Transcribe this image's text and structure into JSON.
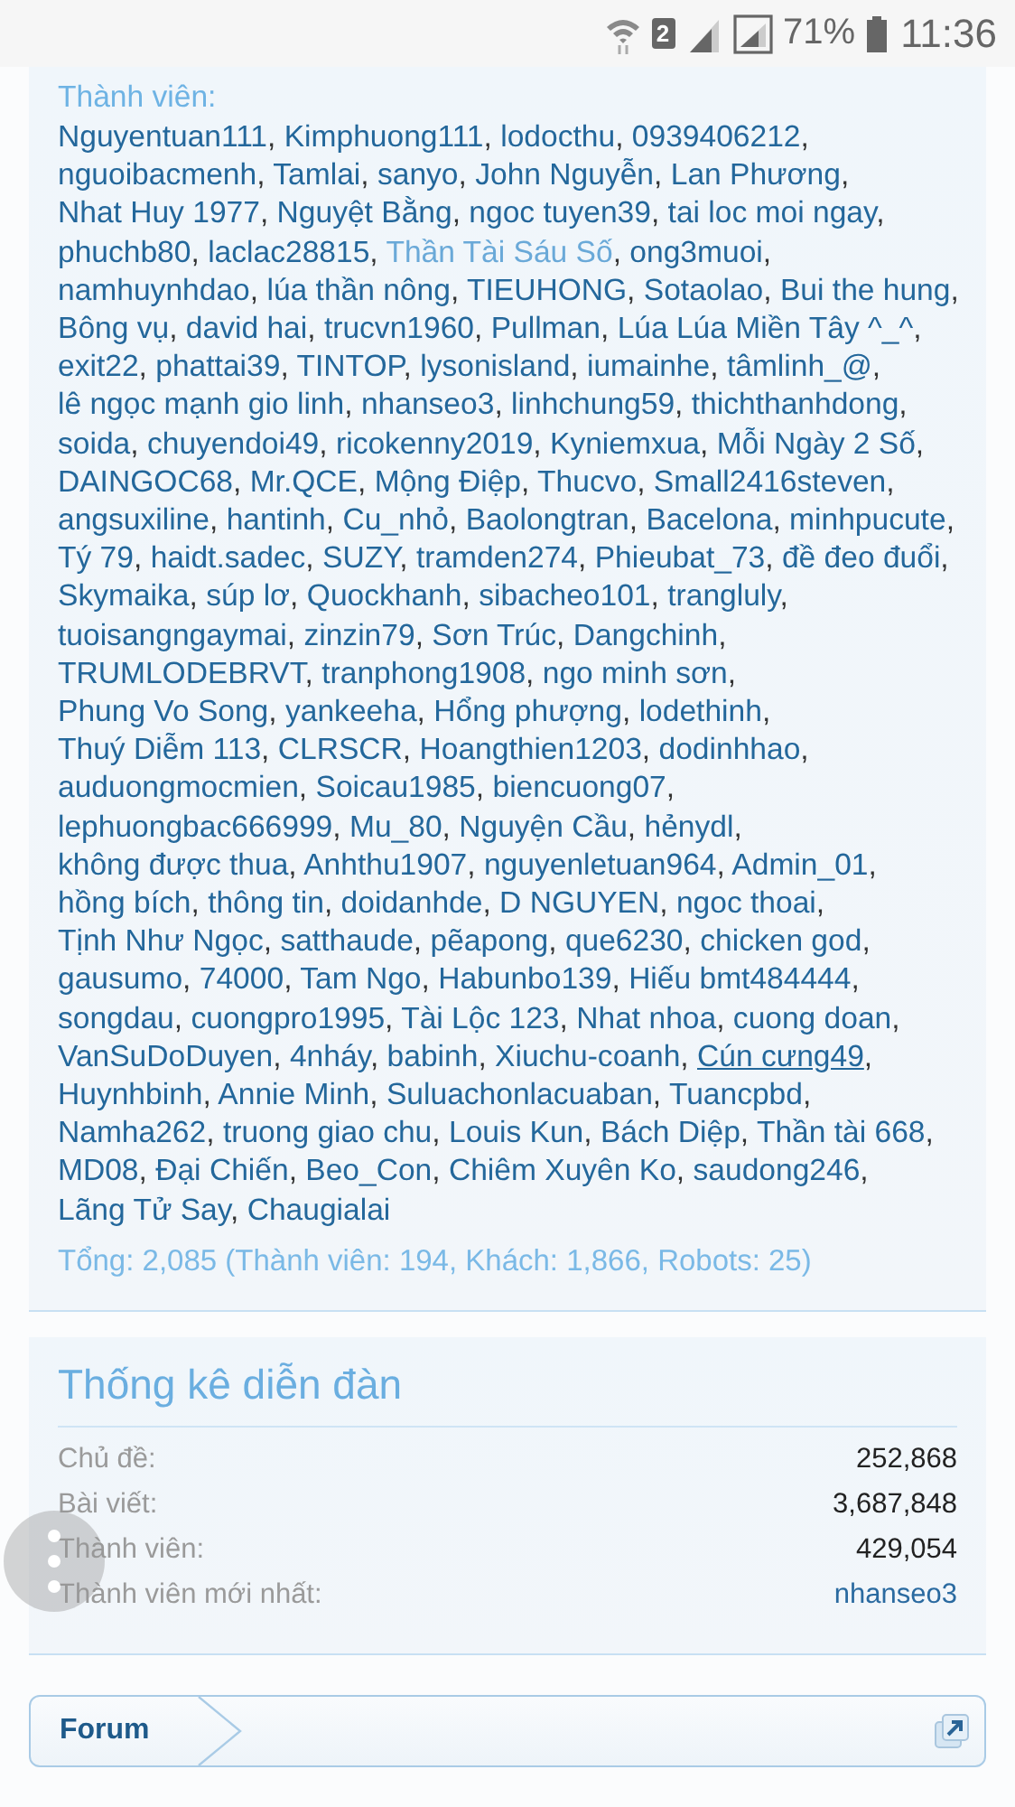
{
  "status_bar": {
    "sim_slot": "2",
    "battery": "71%",
    "time": "11:36"
  },
  "online_members": {
    "heading": "Thành viên:",
    "separator": ",",
    "members": [
      {
        "name": "Nguyentuan111",
        "kind": "member"
      },
      {
        "name": "Kimphuong111",
        "kind": "member"
      },
      {
        "name": "lodocthu",
        "kind": "member"
      },
      {
        "name": "0939406212",
        "kind": "member"
      },
      {
        "name": "nguoibacmenh",
        "kind": "member"
      },
      {
        "name": "Tamlai",
        "kind": "member"
      },
      {
        "name": "sanyo",
        "kind": "member"
      },
      {
        "name": "John Nguyễn",
        "kind": "member"
      },
      {
        "name": "Lan Phương",
        "kind": "member"
      },
      {
        "name": "Nhat Huy 1977",
        "kind": "member"
      },
      {
        "name": "Nguyệt Bằng",
        "kind": "member"
      },
      {
        "name": "ngoc tuyen39",
        "kind": "member"
      },
      {
        "name": "tai loc moi ngay",
        "kind": "member"
      },
      {
        "name": "phuchb80",
        "kind": "member"
      },
      {
        "name": "laclac28815",
        "kind": "member"
      },
      {
        "name": "Thần Tài Sáu Số",
        "kind": "staff"
      },
      {
        "name": "ong3muoi",
        "kind": "member"
      },
      {
        "name": "namhuynhdao",
        "kind": "member"
      },
      {
        "name": "lúa thần nông",
        "kind": "member"
      },
      {
        "name": "TIEUHONG",
        "kind": "member"
      },
      {
        "name": "Sotaolao",
        "kind": "member"
      },
      {
        "name": "Bui the hung",
        "kind": "member"
      },
      {
        "name": "Bông vụ",
        "kind": "member"
      },
      {
        "name": "david hai",
        "kind": "member"
      },
      {
        "name": "trucvn1960",
        "kind": "member"
      },
      {
        "name": "Pullman",
        "kind": "member"
      },
      {
        "name": "Lúa Lúa Miền Tây ^_^",
        "kind": "member"
      },
      {
        "name": "exit22",
        "kind": "member"
      },
      {
        "name": "phattai39",
        "kind": "member"
      },
      {
        "name": "TINTOP",
        "kind": "member"
      },
      {
        "name": "lysonisland",
        "kind": "member"
      },
      {
        "name": "iumainhe",
        "kind": "member"
      },
      {
        "name": "tâmlinh_@",
        "kind": "member"
      },
      {
        "name": "lê ngọc mạnh gio linh",
        "kind": "member"
      },
      {
        "name": "nhanseo3",
        "kind": "member"
      },
      {
        "name": "linhchung59",
        "kind": "member"
      },
      {
        "name": "thichthanhdong",
        "kind": "member"
      },
      {
        "name": "soida",
        "kind": "member"
      },
      {
        "name": "chuyendoi49",
        "kind": "member"
      },
      {
        "name": "ricokenny2019",
        "kind": "member"
      },
      {
        "name": "Kyniemxua",
        "kind": "member"
      },
      {
        "name": "Mỗi Ngày 2 Số",
        "kind": "member"
      },
      {
        "name": "DAINGOC68",
        "kind": "member"
      },
      {
        "name": "Mr.QCE",
        "kind": "member"
      },
      {
        "name": "Mộng Điệp",
        "kind": "member"
      },
      {
        "name": "Thucvo",
        "kind": "member"
      },
      {
        "name": "Small2416steven",
        "kind": "member"
      },
      {
        "name": "angsuxiline",
        "kind": "member"
      },
      {
        "name": "hantinh",
        "kind": "member"
      },
      {
        "name": "Cu_nhỏ",
        "kind": "member"
      },
      {
        "name": "Baolongtran",
        "kind": "member"
      },
      {
        "name": "Bacelona",
        "kind": "member"
      },
      {
        "name": "minhpucute",
        "kind": "member"
      },
      {
        "name": "Tý 79",
        "kind": "member"
      },
      {
        "name": "haidt.sadec",
        "kind": "member"
      },
      {
        "name": "SUZY",
        "kind": "member"
      },
      {
        "name": "tramden274",
        "kind": "member"
      },
      {
        "name": "Phieubat_73",
        "kind": "member"
      },
      {
        "name": "đề đeo đuổi",
        "kind": "member"
      },
      {
        "name": "Skymaika",
        "kind": "member"
      },
      {
        "name": "súp lơ",
        "kind": "member"
      },
      {
        "name": "Quockhanh",
        "kind": "member"
      },
      {
        "name": "sibacheo101",
        "kind": "member"
      },
      {
        "name": "trangluly",
        "kind": "member"
      },
      {
        "name": "tuoisangngaymai",
        "kind": "member"
      },
      {
        "name": "zinzin79",
        "kind": "member"
      },
      {
        "name": "Sơn Trúc",
        "kind": "member"
      },
      {
        "name": "Dangchinh",
        "kind": "member"
      },
      {
        "name": "TRUMLODEBRVT",
        "kind": "member"
      },
      {
        "name": "tranphong1908",
        "kind": "member"
      },
      {
        "name": "ngo minh sơn",
        "kind": "member"
      },
      {
        "name": "Phung Vo Song",
        "kind": "member"
      },
      {
        "name": "yankeeha",
        "kind": "member"
      },
      {
        "name": "Hổng phượng",
        "kind": "member"
      },
      {
        "name": "lodethinh",
        "kind": "member"
      },
      {
        "name": "Thuý Diễm 113",
        "kind": "member"
      },
      {
        "name": "CLRSCR",
        "kind": "member"
      },
      {
        "name": "Hoangthien1203",
        "kind": "member"
      },
      {
        "name": "dodinhhao",
        "kind": "member"
      },
      {
        "name": "auduongmocmien",
        "kind": "member"
      },
      {
        "name": "Soicau1985",
        "kind": "member"
      },
      {
        "name": "biencuong07",
        "kind": "member"
      },
      {
        "name": "lephuongbac666999",
        "kind": "member"
      },
      {
        "name": "Mu_80",
        "kind": "member"
      },
      {
        "name": "Nguyện Cầu",
        "kind": "member"
      },
      {
        "name": "hẻnydl",
        "kind": "member"
      },
      {
        "name": "không được thua",
        "kind": "member"
      },
      {
        "name": "Anhthu1907",
        "kind": "member"
      },
      {
        "name": "nguyenletuan964",
        "kind": "member"
      },
      {
        "name": "Admin_01",
        "kind": "member"
      },
      {
        "name": "hồng bích",
        "kind": "member"
      },
      {
        "name": "thông tin",
        "kind": "member"
      },
      {
        "name": "doidanhde",
        "kind": "member"
      },
      {
        "name": "D NGUYEN",
        "kind": "member"
      },
      {
        "name": "ngoc thoai",
        "kind": "member"
      },
      {
        "name": "Tịnh Như Ngọc",
        "kind": "member"
      },
      {
        "name": "satthaude",
        "kind": "member"
      },
      {
        "name": "pẽapong",
        "kind": "member"
      },
      {
        "name": "que6230",
        "kind": "member"
      },
      {
        "name": "chicken god",
        "kind": "member"
      },
      {
        "name": "gausumo",
        "kind": "member"
      },
      {
        "name": "74000",
        "kind": "member"
      },
      {
        "name": "Tam Ngo",
        "kind": "member"
      },
      {
        "name": "Habunbo139",
        "kind": "member"
      },
      {
        "name": "Hiếu bmt484444",
        "kind": "member"
      },
      {
        "name": "songdau",
        "kind": "member"
      },
      {
        "name": "cuongpro1995",
        "kind": "member"
      },
      {
        "name": "Tài Lộc 123",
        "kind": "member"
      },
      {
        "name": "Nhat nhoa",
        "kind": "member"
      },
      {
        "name": "cuong doan",
        "kind": "member"
      },
      {
        "name": "VanSuDoDuyen",
        "kind": "member"
      },
      {
        "name": "4nháy",
        "kind": "member"
      },
      {
        "name": "babinh",
        "kind": "member"
      },
      {
        "name": "Xiuchu-coanh",
        "kind": "member"
      },
      {
        "name": "Cún cưng49",
        "kind": "underlined"
      },
      {
        "name": "Huynhbinh",
        "kind": "member"
      },
      {
        "name": "Annie Minh",
        "kind": "member"
      },
      {
        "name": "Suluachonlacuaban",
        "kind": "member"
      },
      {
        "name": "Tuancpbd",
        "kind": "member"
      },
      {
        "name": "Namha262",
        "kind": "member"
      },
      {
        "name": "truong giao chu",
        "kind": "member"
      },
      {
        "name": "Louis Kun",
        "kind": "member"
      },
      {
        "name": "Bách Diệp",
        "kind": "member"
      },
      {
        "name": "Thần tài 668",
        "kind": "member"
      },
      {
        "name": "MD08",
        "kind": "member"
      },
      {
        "name": "Đại Chiến",
        "kind": "member"
      },
      {
        "name": "Beo_Con",
        "kind": "member"
      },
      {
        "name": "Chiêm Xuyên Ko",
        "kind": "member"
      },
      {
        "name": "saudong246",
        "kind": "member"
      },
      {
        "name": "Lãng Tử Say",
        "kind": "member"
      },
      {
        "name": "Chaugialai",
        "kind": "member"
      }
    ],
    "total": "Tổng: 2,085 (Thành viên: 194, Khách: 1,866, Robots: 25)"
  },
  "forum_stats": {
    "title": "Thống kê diễn đàn",
    "rows": [
      {
        "label": "Chủ đề:",
        "value": "252,868",
        "kind": "number"
      },
      {
        "label": "Bài viết:",
        "value": "3,687,848",
        "kind": "number"
      },
      {
        "label": "Thành viên:",
        "value": "429,054",
        "kind": "number"
      },
      {
        "label": "Thành viên mới nhất:",
        "value": "nhanseo3",
        "kind": "link"
      }
    ]
  },
  "breadcrumb": {
    "items": [
      "Forum"
    ]
  }
}
